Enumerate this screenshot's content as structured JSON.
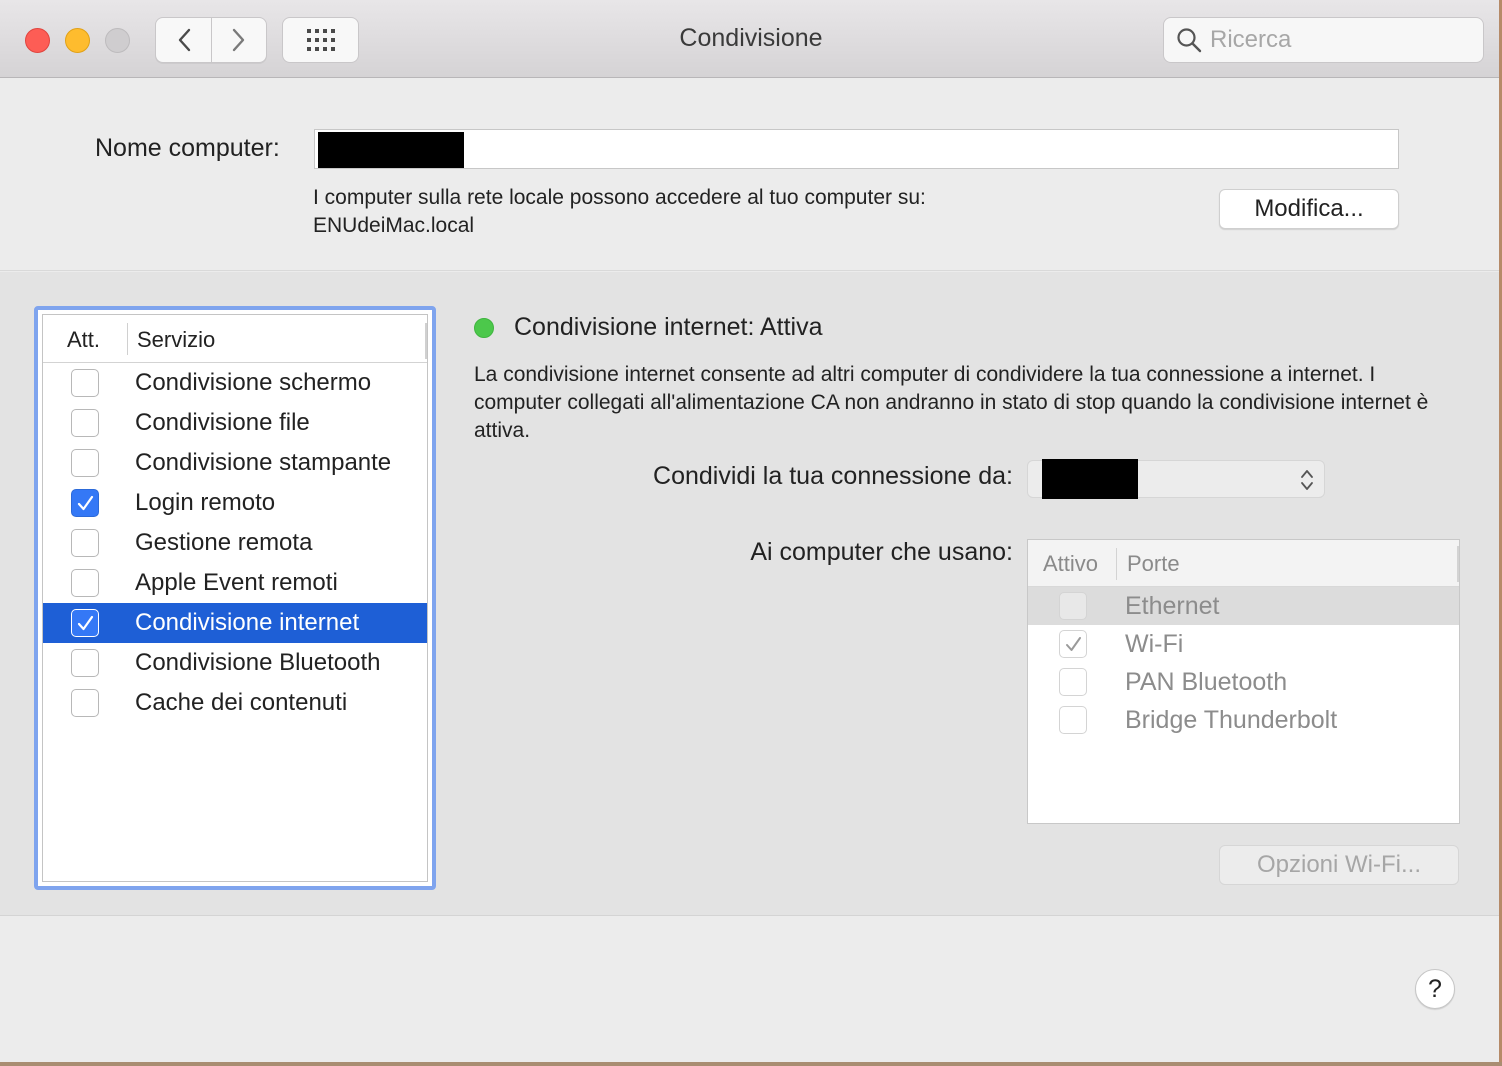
{
  "window": {
    "title": "Condivisione"
  },
  "search": {
    "placeholder": "Ricerca"
  },
  "computer_name": {
    "label": "Nome computer:",
    "value": "",
    "info_line1": "I computer sulla rete locale possono accedere al tuo computer su:",
    "info_line2": "ENUdeiMac.local",
    "edit_button": "Modifica..."
  },
  "services": {
    "col_on": "Att.",
    "col_service": "Servizio",
    "items": [
      {
        "label": "Condivisione schermo",
        "checked": false,
        "selected": false
      },
      {
        "label": "Condivisione file",
        "checked": false,
        "selected": false
      },
      {
        "label": "Condivisione stampante",
        "checked": false,
        "selected": false
      },
      {
        "label": "Login remoto",
        "checked": true,
        "selected": false
      },
      {
        "label": "Gestione remota",
        "checked": false,
        "selected": false
      },
      {
        "label": "Apple Event remoti",
        "checked": false,
        "selected": false
      },
      {
        "label": "Condivisione internet",
        "checked": true,
        "selected": true
      },
      {
        "label": "Condivisione Bluetooth",
        "checked": false,
        "selected": false
      },
      {
        "label": "Cache dei contenuti",
        "checked": false,
        "selected": false
      }
    ]
  },
  "detail": {
    "status_title": "Condivisione internet: Attiva",
    "status_color": "#4cc84b",
    "description": "La condivisione internet consente ad altri computer di condividere la tua connessione a internet. I computer collegati all'alimentazione CA non andranno in stato di stop quando la condivisione internet è attiva.",
    "share_from_label": "Condividi la tua connessione da:",
    "share_from_value": "",
    "to_computers_label": "Ai computer che usano:",
    "ports_col_active": "Attivo",
    "ports_col_ports": "Porte",
    "ports": [
      {
        "label": "Ethernet",
        "checked": false,
        "selected": true
      },
      {
        "label": "Wi-Fi",
        "checked": true,
        "selected": false
      },
      {
        "label": "PAN Bluetooth",
        "checked": false,
        "selected": false
      },
      {
        "label": "Bridge Thunderbolt",
        "checked": false,
        "selected": false
      }
    ],
    "wifi_options_button": "Opzioni Wi-Fi..."
  },
  "help_button": "?",
  "colors": {
    "accent": "#3478f6",
    "selection": "#1e5fd6",
    "focus_ring": "#7fa4ee"
  }
}
